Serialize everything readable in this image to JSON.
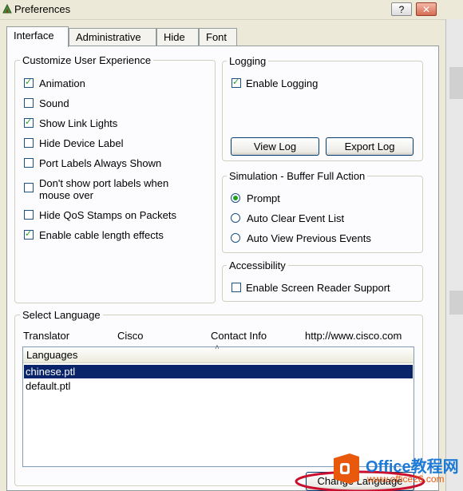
{
  "window": {
    "title": "Preferences",
    "help_label": "?",
    "close_label": "✕"
  },
  "tabs": [
    {
      "label": "Interface",
      "active": true
    },
    {
      "label": "Administrative",
      "active": false
    },
    {
      "label": "Hide",
      "active": false
    },
    {
      "label": "Font",
      "active": false
    }
  ],
  "customize": {
    "title": "Customize User Experience",
    "options": [
      {
        "label": "Animation",
        "checked": true
      },
      {
        "label": "Sound",
        "checked": false
      },
      {
        "label": "Show Link Lights",
        "checked": true
      },
      {
        "label": "Hide Device Label",
        "checked": false
      },
      {
        "label": "Port Labels Always Shown",
        "checked": false
      },
      {
        "label": "Don't show port labels when mouse over",
        "checked": false
      },
      {
        "label": "Hide QoS Stamps on Packets",
        "checked": false
      },
      {
        "label": "Enable cable length effects",
        "checked": true
      }
    ]
  },
  "logging": {
    "title": "Logging",
    "enable_label": "Enable Logging",
    "enable_checked": true,
    "view_log": "View Log",
    "export_log": "Export Log"
  },
  "simulation": {
    "title": "Simulation - Buffer Full Action",
    "options": [
      {
        "label": "Prompt",
        "selected": true
      },
      {
        "label": "Auto Clear Event List",
        "selected": false
      },
      {
        "label": "Auto View Previous Events",
        "selected": false
      }
    ]
  },
  "accessibility": {
    "title": "Accessibility",
    "screen_reader_label": "Enable Screen Reader Support",
    "screen_reader_checked": false
  },
  "language": {
    "title": "Select Language",
    "translator_label": "Translator",
    "translator_value": "Cisco",
    "contact_label": "Contact Info",
    "contact_value": "http://www.cisco.com",
    "list_header": "Languages",
    "items": [
      {
        "label": "chinese.ptl",
        "selected": true
      },
      {
        "label": "default.ptl",
        "selected": false
      }
    ],
    "change_button": "Change Language"
  },
  "watermark": {
    "brand": "Office教程网",
    "url": "www.office26.com"
  },
  "colors": {
    "selection": "#0a246a",
    "check": "#21a121",
    "tab_border": "#919b9c",
    "annotation": "#c8102e",
    "brand_orange": "#e8590c"
  }
}
